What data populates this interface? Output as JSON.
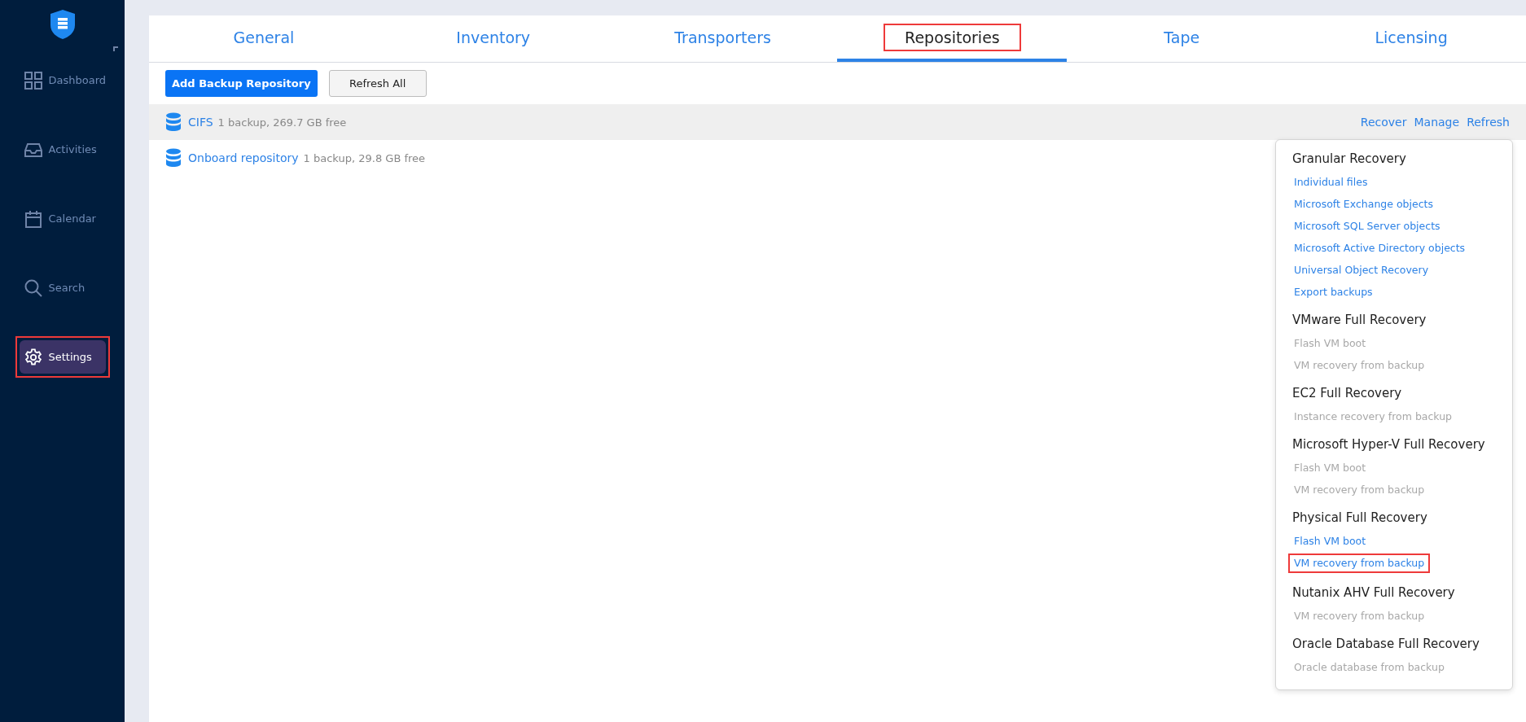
{
  "sidebar": {
    "items": [
      {
        "label": "Dashboard",
        "selected": false,
        "highlighted": false
      },
      {
        "label": "Activities",
        "selected": false,
        "highlighted": false
      },
      {
        "label": "Calendar",
        "selected": false,
        "highlighted": false
      },
      {
        "label": "Search",
        "selected": false,
        "highlighted": false
      },
      {
        "label": "Settings",
        "selected": true,
        "highlighted": true
      }
    ]
  },
  "tabs": [
    {
      "label": "General",
      "selected": false,
      "highlighted": false
    },
    {
      "label": "Inventory",
      "selected": false,
      "highlighted": false
    },
    {
      "label": "Transporters",
      "selected": false,
      "highlighted": false
    },
    {
      "label": "Repositories",
      "selected": true,
      "highlighted": true
    },
    {
      "label": "Tape",
      "selected": false,
      "highlighted": false
    },
    {
      "label": "Licensing",
      "selected": false,
      "highlighted": false
    }
  ],
  "toolbar": {
    "primary": "Add Backup Repository",
    "secondary": "Refresh All"
  },
  "repositories": [
    {
      "name": "CIFS",
      "details": "1 backup, 269.7 GB free",
      "selected": true,
      "actions": [
        "Recover",
        "Manage",
        "Refresh"
      ]
    },
    {
      "name": "Onboard repository",
      "details": "1 backup, 29.8 GB free",
      "selected": false
    }
  ],
  "recover_menu": {
    "sections": [
      {
        "title": "Granular Recovery",
        "items": [
          {
            "label": "Individual files",
            "enabled": true,
            "highlighted": false
          },
          {
            "label": "Microsoft Exchange objects",
            "enabled": true,
            "highlighted": false
          },
          {
            "label": "Microsoft SQL Server objects",
            "enabled": true,
            "highlighted": false
          },
          {
            "label": "Microsoft Active Directory objects",
            "enabled": true,
            "highlighted": false
          },
          {
            "label": "Universal Object Recovery",
            "enabled": true,
            "highlighted": false
          },
          {
            "label": "Export backups",
            "enabled": true,
            "highlighted": false
          }
        ]
      },
      {
        "title": "VMware Full Recovery",
        "items": [
          {
            "label": "Flash VM boot",
            "enabled": false,
            "highlighted": false
          },
          {
            "label": "VM recovery from backup",
            "enabled": false,
            "highlighted": false
          }
        ]
      },
      {
        "title": "EC2 Full Recovery",
        "items": [
          {
            "label": "Instance recovery from backup",
            "enabled": false,
            "highlighted": false
          }
        ]
      },
      {
        "title": "Microsoft Hyper-V Full Recovery",
        "items": [
          {
            "label": "Flash VM boot",
            "enabled": false,
            "highlighted": false
          },
          {
            "label": "VM recovery from backup",
            "enabled": false,
            "highlighted": false
          }
        ]
      },
      {
        "title": "Physical Full Recovery",
        "items": [
          {
            "label": "Flash VM boot",
            "enabled": true,
            "highlighted": false
          },
          {
            "label": "VM recovery from backup",
            "enabled": true,
            "highlighted": true
          }
        ]
      },
      {
        "title": "Nutanix AHV Full Recovery",
        "items": [
          {
            "label": "VM recovery from backup",
            "enabled": false,
            "highlighted": false
          }
        ]
      },
      {
        "title": "Oracle Database Full Recovery",
        "items": [
          {
            "label": "Oracle database from backup",
            "enabled": false,
            "highlighted": false
          }
        ]
      }
    ]
  }
}
